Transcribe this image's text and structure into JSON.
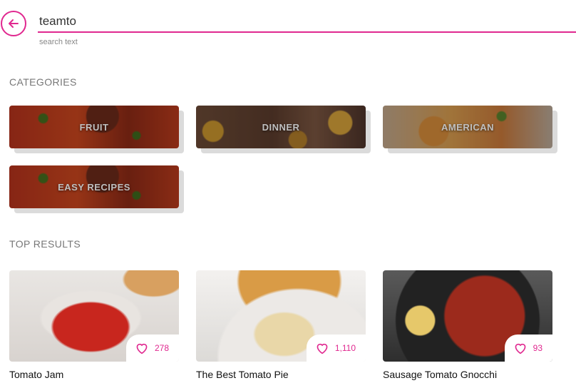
{
  "search": {
    "value": "teamto",
    "helper": "search text"
  },
  "categories_heading": "CATEGORIES",
  "categories": [
    {
      "label": "FRUIT"
    },
    {
      "label": "DINNER"
    },
    {
      "label": "AMERICAN"
    },
    {
      "label": "EASY RECIPES"
    }
  ],
  "top_results_heading": "TOP RESULTS",
  "results": [
    {
      "title": "Tomato Jam",
      "likes": "278"
    },
    {
      "title": "The Best Tomato Pie",
      "likes": "1,110"
    },
    {
      "title": "Sausage Tomato Gnocchi",
      "likes": "93"
    }
  ],
  "colors": {
    "accent": "#e0288f"
  },
  "icons": {
    "back": "arrow-left-icon",
    "like": "heart-outline-icon"
  }
}
